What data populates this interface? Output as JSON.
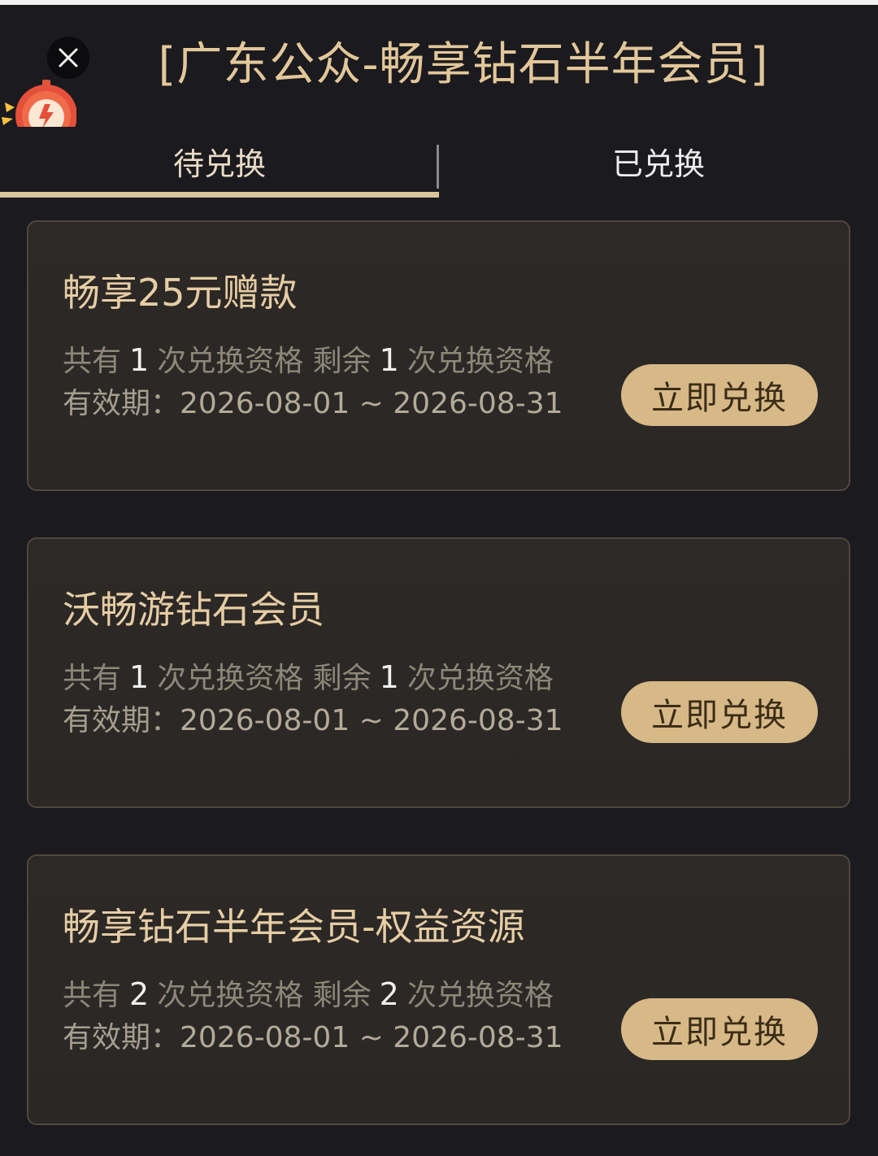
{
  "header": {
    "title": "[广东公众-畅享钻石半年会员]",
    "close_icon": "close-icon",
    "mascot_icon": "mascot-clock-icon"
  },
  "tabs": [
    {
      "label": "待兑换",
      "active": true
    },
    {
      "label": "已兑换",
      "active": false
    }
  ],
  "colors": {
    "accent": "#d6b987",
    "title_gold": "#e2c79a",
    "background": "#1b1a1e",
    "card_bg": "#2c2826"
  },
  "cards": [
    {
      "title": "畅享25元赠款",
      "quota_prefix": "共有",
      "total": "1",
      "quota_mid": "次兑换资格 剩余",
      "remaining": "1",
      "quota_suffix": "次兑换资格",
      "validity_label": "有效期：",
      "validity_range": "2026-08-01 ~ 2026-08-31",
      "button_label": "立即兑换"
    },
    {
      "title": "沃畅游钻石会员",
      "quota_prefix": "共有",
      "total": "1",
      "quota_mid": "次兑换资格 剩余",
      "remaining": "1",
      "quota_suffix": "次兑换资格",
      "validity_label": "有效期：",
      "validity_range": "2026-08-01 ~ 2026-08-31",
      "button_label": "立即兑换"
    },
    {
      "title": "畅享钻石半年会员-权益资源",
      "quota_prefix": "共有",
      "total": "2",
      "quota_mid": "次兑换资格 剩余",
      "remaining": "2",
      "quota_suffix": "次兑换资格",
      "validity_label": "有效期：",
      "validity_range": "2026-08-01 ~ 2026-08-31",
      "button_label": "立即兑换"
    }
  ]
}
